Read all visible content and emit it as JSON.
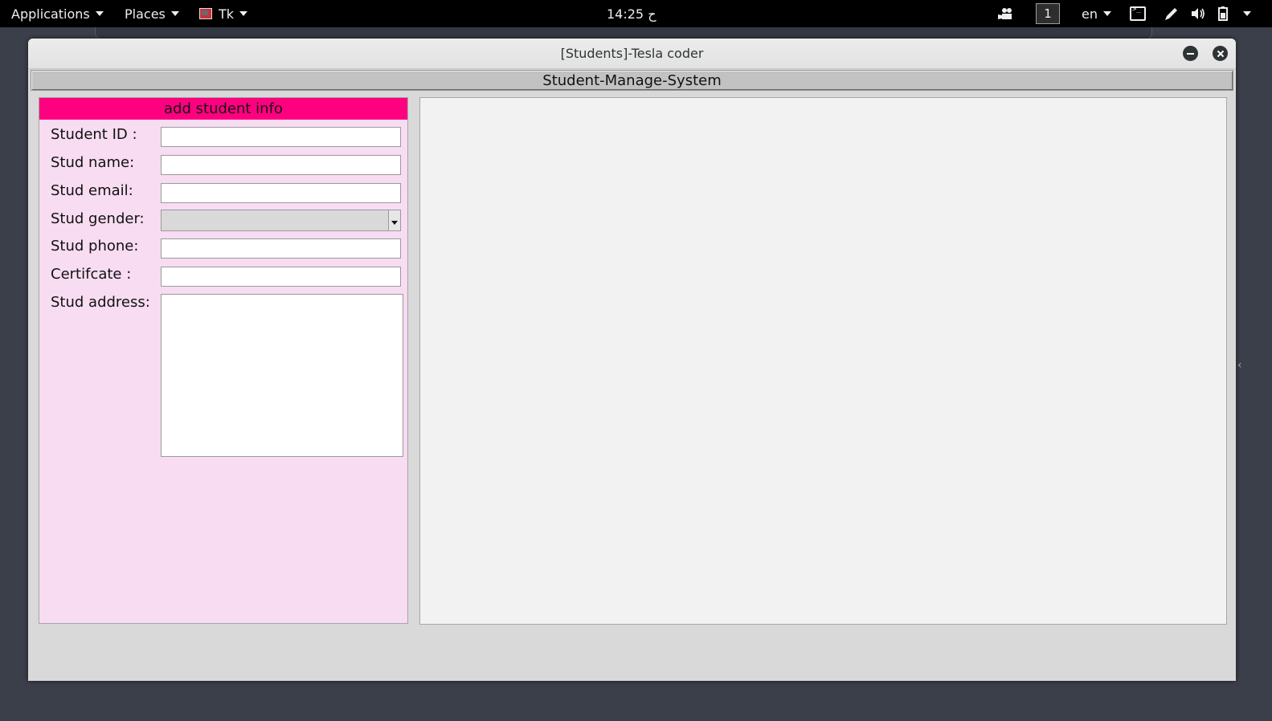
{
  "topbar": {
    "applications_label": "Applications",
    "places_label": "Places",
    "app_label": "Tk",
    "clock": "14:25 ح",
    "workspace_number": "1",
    "language": "en",
    "icons": [
      "video-camera-icon",
      "terminal-icon",
      "pen-icon",
      "volume-icon",
      "battery-icon",
      "chevron-down-icon"
    ]
  },
  "window": {
    "title": "[Students]-Tesla coder",
    "header": "Student-Manage-System"
  },
  "form": {
    "section_title": "add student info",
    "section_color": "#ff0080",
    "panel_color": "#f7dcf2",
    "fields": {
      "id_label": "Student ID :",
      "id_value": "",
      "name_label": "Stud name:",
      "name_value": "",
      "email_label": "Stud email:",
      "email_value": "",
      "gender_label": "Stud gender:",
      "gender_value": "",
      "phone_label": "Stud phone:",
      "phone_value": "",
      "certificate_label": "Certifcate :",
      "certificate_value": "",
      "address_label": "Stud address:",
      "address_value": ""
    }
  }
}
